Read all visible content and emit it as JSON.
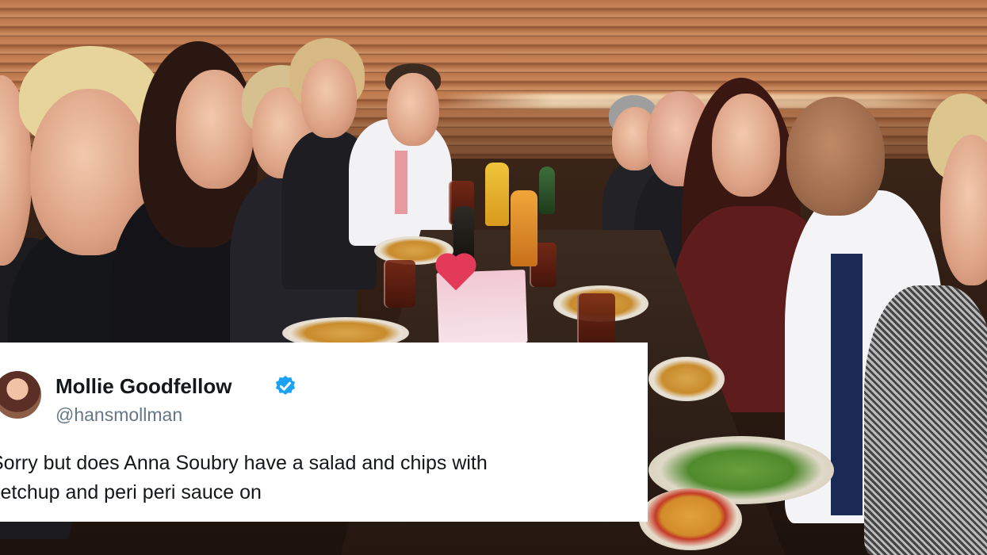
{
  "tweet": {
    "display_name": "Mollie Goodfellow",
    "handle": "@hansmollman",
    "verified": true,
    "avatar_icon": "profile-photo",
    "verified_icon": "verified-badge-icon",
    "text_lines": [
      "Sorry but does Anna Soubry have a salad and chips with",
      "ketchup and peri peri sauce on"
    ]
  },
  "photo": {
    "scene": "group-dinner-photo"
  },
  "colors": {
    "verified_blue": "#1da1f2",
    "name_text": "#14171a",
    "handle_text": "#657786",
    "card_bg": "#ffffff"
  }
}
